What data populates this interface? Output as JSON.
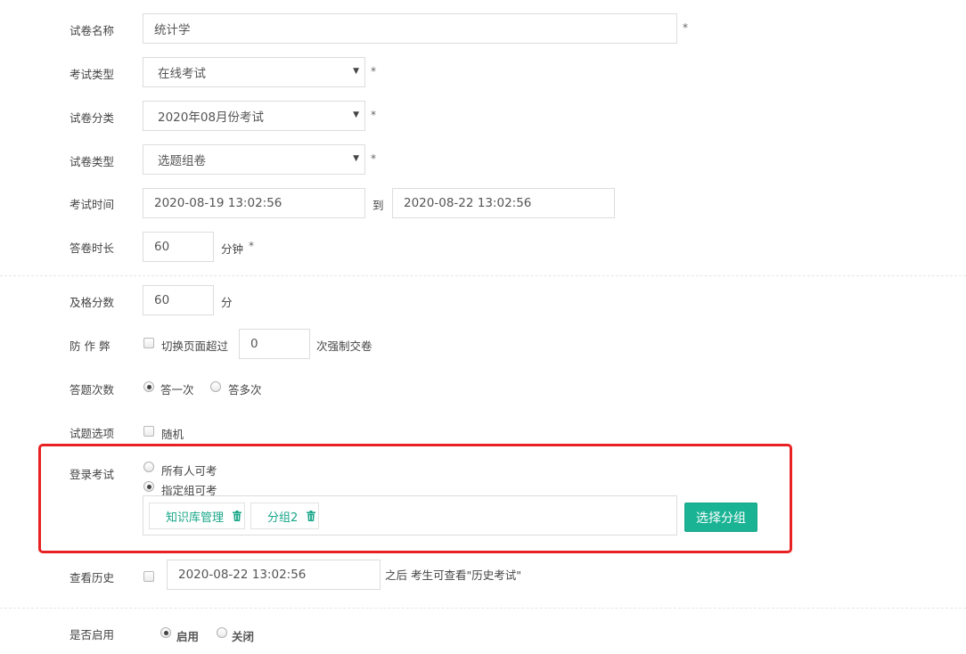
{
  "fields": {
    "paper_name": {
      "label": "试卷名称",
      "value": "统计学",
      "required": "*"
    },
    "exam_type": {
      "label": "考试类型",
      "value": "在线考试",
      "required": "*"
    },
    "paper_category": {
      "label": "试卷分类",
      "value": "2020年08月份考试",
      "required": "*"
    },
    "paper_type": {
      "label": "试卷类型",
      "value": "选题组卷",
      "required": "*"
    },
    "exam_time": {
      "label": "考试时间",
      "start": "2020-08-19 13:02:56",
      "to": "到",
      "end": "2020-08-22 13:02:56"
    },
    "duration": {
      "label": "答卷时长",
      "value": "60",
      "unit": "分钟",
      "required": "*"
    },
    "pass_score": {
      "label": "及格分数",
      "value": "60",
      "unit": "分"
    },
    "anti_cheat": {
      "label": "防 作 弊",
      "check_label": "切换页面超过",
      "value": "0",
      "suffix": "次强制交卷"
    },
    "answer_times": {
      "label": "答题次数",
      "options": [
        "答一次",
        "答多次"
      ],
      "selected": "答一次"
    },
    "question_options": {
      "label": "试题选项",
      "check_label": "随机"
    },
    "login_exam": {
      "label": "登录考试",
      "options": [
        "所有人可考",
        "指定组可考"
      ],
      "selected": "指定组可考",
      "groups": [
        "知识库管理",
        "分组2"
      ],
      "select_button": "选择分组"
    },
    "view_history": {
      "label": "查看历史",
      "value": "2020-08-22 13:02:56",
      "suffix": "之后 考生可查看\"历史考试\""
    },
    "enabled": {
      "label": "是否启用",
      "options": [
        "启用",
        "关闭"
      ],
      "selected": "启用"
    }
  },
  "colors": {
    "accent": "#1ab394",
    "tag_text": "#18a689",
    "highlight": "#e82222"
  },
  "icons": {
    "dropdown": "chevron-down-icon",
    "tag_delete": "trash-icon"
  }
}
